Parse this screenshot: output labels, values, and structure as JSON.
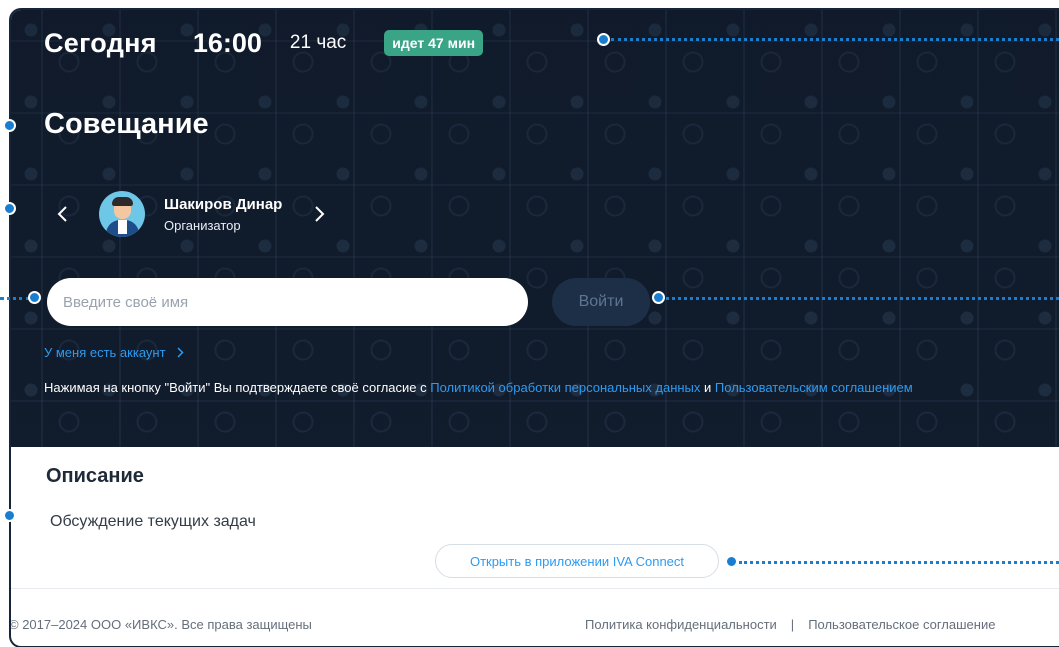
{
  "header": {
    "today": "Сегодня",
    "time": "16:00",
    "duration": "21 час",
    "status_badge": "идет 47 мин"
  },
  "meeting": {
    "title": "Совещание",
    "organizer_name": "Шакиров Динар",
    "organizer_role": "Организатор"
  },
  "login": {
    "name_placeholder": "Введите своё имя",
    "name_value": "",
    "login_button": "Войти",
    "account_link": "У меня есть аккаунт",
    "consent_prefix": "Нажимая на кнопку \"Войти\" Вы подтверждаете своё согласие с",
    "consent_link_privacy": "Политикой обработки персональных данных",
    "consent_and": "и",
    "consent_link_terms": "Пользовательским соглашением"
  },
  "description": {
    "title": "Описание",
    "text": "Обсуждение текущих задач",
    "open_app_button": "Открыть в приложении IVA Connect"
  },
  "footer": {
    "copyright": "© 2017–2024 ООО «ИВКС». Все права защищены",
    "privacy_link": "Политика конфиденциальности",
    "separator": "|",
    "terms_link": "Пользовательское соглашение"
  },
  "colors": {
    "hero_background": "#111c2d",
    "badge_green": "#3aa487",
    "link_blue": "#2d9bf0",
    "annotation_blue": "#1a7ed0"
  },
  "icons": [
    "chevron-left-icon",
    "chevron-right-icon",
    "avatar",
    "chevron-right-small-icon"
  ]
}
